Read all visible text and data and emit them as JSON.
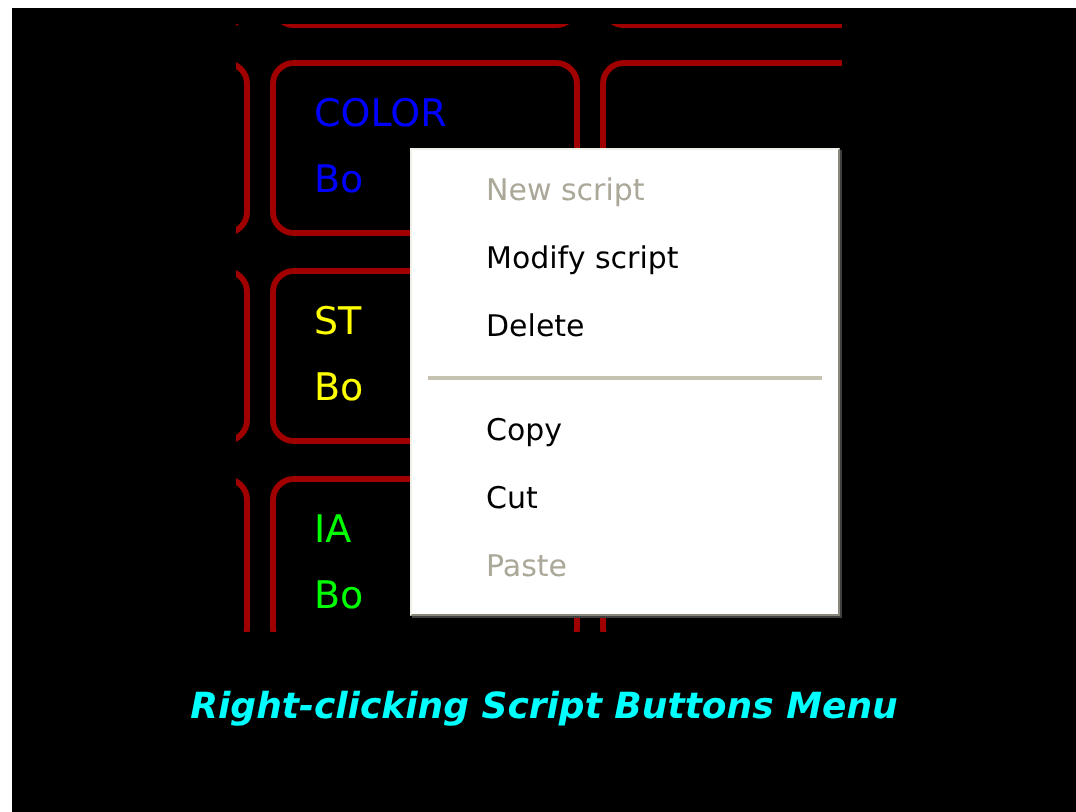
{
  "button_grid": {
    "rows": [
      {
        "buttons": [
          {
            "kind": "blank"
          },
          {
            "kind": "blank"
          },
          {
            "kind": "blank"
          }
        ]
      },
      {
        "buttons": [
          {
            "kind": "blank"
          },
          {
            "kind": "labeled",
            "lines": [
              "COLOR",
              "Bo"
            ],
            "color": "#0000ff"
          },
          {
            "kind": "blank"
          }
        ]
      },
      {
        "buttons": [
          {
            "kind": "blank"
          },
          {
            "kind": "labeled",
            "lines": [
              "ST",
              "Bo"
            ],
            "color": "#ffff00"
          }
        ]
      },
      {
        "buttons": [
          {
            "kind": "blank"
          },
          {
            "kind": "labeled",
            "lines": [
              "IA",
              "Bo"
            ],
            "color": "#00ff00"
          },
          {
            "kind": "blank"
          }
        ]
      }
    ]
  },
  "context_menu": {
    "items": [
      {
        "kind": "item",
        "label": "New script",
        "disabled": true
      },
      {
        "kind": "item",
        "label": "Modify script",
        "disabled": false
      },
      {
        "kind": "item",
        "label": "Delete",
        "disabled": false
      },
      {
        "kind": "separator"
      },
      {
        "kind": "item",
        "label": "Copy",
        "disabled": false
      },
      {
        "kind": "item",
        "label": "Cut",
        "disabled": false
      },
      {
        "kind": "item",
        "label": "Paste",
        "disabled": true
      }
    ]
  },
  "caption": "Right-clicking Script Buttons Menu"
}
